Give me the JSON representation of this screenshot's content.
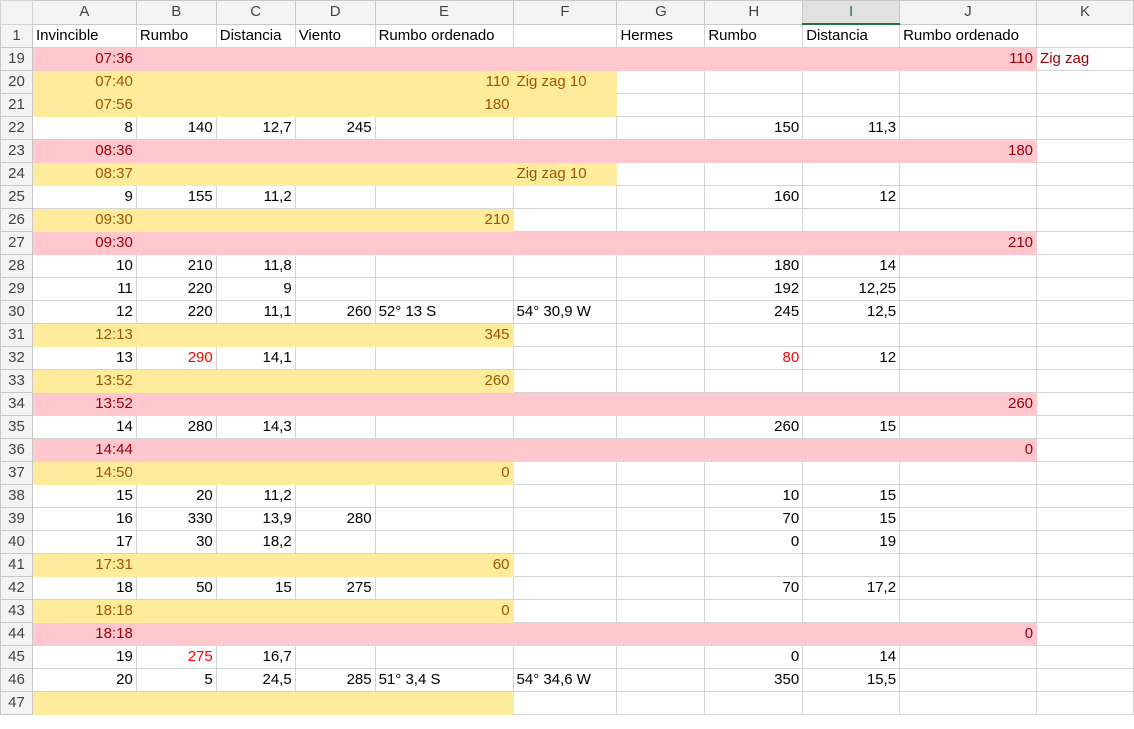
{
  "columns": [
    "A",
    "B",
    "C",
    "D",
    "E",
    "F",
    "G",
    "H",
    "I",
    "J",
    "K"
  ],
  "header_row": {
    "n": "1",
    "cells": [
      "Invincible",
      "Rumbo",
      "Distancia",
      "Viento",
      "Rumbo ordenado",
      "",
      "Hermes",
      "Rumbo",
      "Distancia",
      "Rumbo ordenado",
      ""
    ]
  },
  "rows": [
    {
      "n": "19",
      "type": "pink",
      "span": 10,
      "cells": [
        "07:36",
        "",
        "",
        "",
        "",
        "",
        "",
        "",
        "",
        "110",
        "Zig zag"
      ]
    },
    {
      "n": "20",
      "type": "yellow",
      "span": 6,
      "cells": [
        "07:40",
        "",
        "",
        "",
        "110",
        "Zig zag 10",
        "",
        "",
        "",
        "",
        ""
      ]
    },
    {
      "n": "21",
      "type": "yellow",
      "span": 6,
      "cells": [
        "07:56",
        "",
        "",
        "",
        "180",
        "",
        "",
        "",
        "",
        "",
        ""
      ]
    },
    {
      "n": "22",
      "type": "plain",
      "cells": [
        "8",
        "140",
        "12,7",
        "245",
        "",
        "",
        "",
        "150",
        "11,3",
        "",
        ""
      ]
    },
    {
      "n": "23",
      "type": "pink",
      "span": 10,
      "cells": [
        "08:36",
        "",
        "",
        "",
        "",
        "",
        "",
        "",
        "",
        "180",
        ""
      ]
    },
    {
      "n": "24",
      "type": "yellow",
      "span": 6,
      "cells": [
        "08:37",
        "",
        "",
        "",
        "",
        "Zig zag 10",
        "",
        "",
        "",
        "",
        ""
      ]
    },
    {
      "n": "25",
      "type": "plain",
      "cells": [
        "9",
        "155",
        "11,2",
        "",
        "",
        "",
        "",
        "160",
        "12",
        "",
        ""
      ]
    },
    {
      "n": "26",
      "type": "yellow",
      "span": 5,
      "cells": [
        "09:30",
        "",
        "",
        "",
        "210",
        "",
        "",
        "",
        "",
        "",
        ""
      ]
    },
    {
      "n": "27",
      "type": "pink",
      "span": 10,
      "cells": [
        "09:30",
        "",
        "",
        "",
        "",
        "",
        "",
        "",
        "",
        "210",
        ""
      ]
    },
    {
      "n": "28",
      "type": "plain",
      "cells": [
        "10",
        "210",
        "11,8",
        "",
        "",
        "",
        "",
        "180",
        "14",
        "",
        ""
      ]
    },
    {
      "n": "29",
      "type": "plain",
      "cells": [
        "11",
        "220",
        "9",
        "",
        "",
        "",
        "",
        "192",
        "12,25",
        "",
        ""
      ]
    },
    {
      "n": "30",
      "type": "plain",
      "cells": [
        "12",
        "220",
        "11,1",
        "260",
        "52° 13 S",
        "54° 30,9 W",
        "",
        "245",
        "12,5",
        "",
        ""
      ]
    },
    {
      "n": "31",
      "type": "yellow",
      "span": 5,
      "cells": [
        "12:13",
        "",
        "",
        "",
        "345",
        "",
        "",
        "",
        "",
        "",
        ""
      ]
    },
    {
      "n": "32",
      "type": "plain",
      "red": [
        1,
        7
      ],
      "cells": [
        "13",
        "290",
        "14,1",
        "",
        "",
        "",
        "",
        "80",
        "12",
        "",
        ""
      ]
    },
    {
      "n": "33",
      "type": "yellow",
      "span": 5,
      "cells": [
        "13:52",
        "",
        "",
        "",
        "260",
        "",
        "",
        "",
        "",
        "",
        ""
      ]
    },
    {
      "n": "34",
      "type": "pink",
      "span": 10,
      "cells": [
        "13:52",
        "",
        "",
        "",
        "",
        "",
        "",
        "",
        "",
        "260",
        ""
      ]
    },
    {
      "n": "35",
      "type": "plain",
      "cells": [
        "14",
        "280",
        "14,3",
        "",
        "",
        "",
        "",
        "260",
        "15",
        "",
        ""
      ]
    },
    {
      "n": "36",
      "type": "pink",
      "span": 10,
      "cells": [
        "14:44",
        "",
        "",
        "",
        "",
        "",
        "",
        "",
        "",
        "0",
        ""
      ]
    },
    {
      "n": "37",
      "type": "yellow",
      "span": 5,
      "cells": [
        "14:50",
        "",
        "",
        "",
        "0",
        "",
        "",
        "",
        "",
        "",
        ""
      ]
    },
    {
      "n": "38",
      "type": "plain",
      "cells": [
        "15",
        "20",
        "11,2",
        "",
        "",
        "",
        "",
        "10",
        "15",
        "",
        ""
      ]
    },
    {
      "n": "39",
      "type": "plain",
      "cells": [
        "16",
        "330",
        "13,9",
        "280",
        "",
        "",
        "",
        "70",
        "15",
        "",
        ""
      ]
    },
    {
      "n": "40",
      "type": "plain",
      "cells": [
        "17",
        "30",
        "18,2",
        "",
        "",
        "",
        "",
        "0",
        "19",
        "",
        ""
      ]
    },
    {
      "n": "41",
      "type": "yellow",
      "span": 5,
      "cells": [
        "17:31",
        "",
        "",
        "",
        "60",
        "",
        "",
        "",
        "",
        "",
        ""
      ]
    },
    {
      "n": "42",
      "type": "plain",
      "cells": [
        "18",
        "50",
        "15",
        "275",
        "",
        "",
        "",
        "70",
        "17,2",
        "",
        ""
      ]
    },
    {
      "n": "43",
      "type": "yellow",
      "span": 5,
      "cells": [
        "18:18",
        "",
        "",
        "",
        "0",
        "",
        "",
        "",
        "",
        "",
        ""
      ]
    },
    {
      "n": "44",
      "type": "pink",
      "span": 10,
      "cells": [
        "18:18",
        "",
        "",
        "",
        "",
        "",
        "",
        "",
        "",
        "0",
        ""
      ]
    },
    {
      "n": "45",
      "type": "plain",
      "red": [
        1
      ],
      "cells": [
        "19",
        "275",
        "16,7",
        "",
        "",
        "",
        "",
        "0",
        "14",
        "",
        ""
      ]
    },
    {
      "n": "46",
      "type": "plain",
      "cells": [
        "20",
        "5",
        "24,5",
        "285",
        "51° 3,4 S",
        "54° 34,6 W",
        "",
        "350",
        "15,5",
        "",
        ""
      ]
    },
    {
      "n": "47",
      "type": "yellow",
      "span": 5,
      "cells": [
        "",
        "",
        "",
        "",
        "",
        "",
        "",
        "",
        "",
        "",
        ""
      ]
    }
  ],
  "selected_column": "I",
  "colors": {
    "pink_fill": "#ffc7ce",
    "pink_text": "#9c0006",
    "yellow_fill": "#ffeb9c",
    "yellow_text": "#9c5700",
    "red_text": "#ff0000",
    "selection": "#217346"
  }
}
